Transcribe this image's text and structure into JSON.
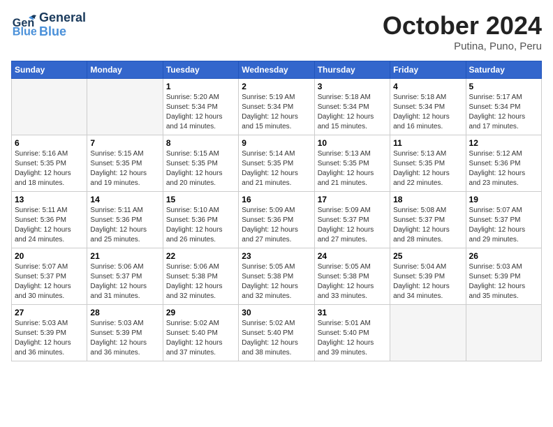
{
  "header": {
    "logo_general": "General",
    "logo_blue": "Blue",
    "month": "October 2024",
    "location": "Putina, Puno, Peru"
  },
  "weekdays": [
    "Sunday",
    "Monday",
    "Tuesday",
    "Wednesday",
    "Thursday",
    "Friday",
    "Saturday"
  ],
  "weeks": [
    [
      {
        "day": "",
        "sunrise": "",
        "sunset": "",
        "daylight": ""
      },
      {
        "day": "",
        "sunrise": "",
        "sunset": "",
        "daylight": ""
      },
      {
        "day": "1",
        "sunrise": "Sunrise: 5:20 AM",
        "sunset": "Sunset: 5:34 PM",
        "daylight": "Daylight: 12 hours and 14 minutes."
      },
      {
        "day": "2",
        "sunrise": "Sunrise: 5:19 AM",
        "sunset": "Sunset: 5:34 PM",
        "daylight": "Daylight: 12 hours and 15 minutes."
      },
      {
        "day": "3",
        "sunrise": "Sunrise: 5:18 AM",
        "sunset": "Sunset: 5:34 PM",
        "daylight": "Daylight: 12 hours and 15 minutes."
      },
      {
        "day": "4",
        "sunrise": "Sunrise: 5:18 AM",
        "sunset": "Sunset: 5:34 PM",
        "daylight": "Daylight: 12 hours and 16 minutes."
      },
      {
        "day": "5",
        "sunrise": "Sunrise: 5:17 AM",
        "sunset": "Sunset: 5:34 PM",
        "daylight": "Daylight: 12 hours and 17 minutes."
      }
    ],
    [
      {
        "day": "6",
        "sunrise": "Sunrise: 5:16 AM",
        "sunset": "Sunset: 5:35 PM",
        "daylight": "Daylight: 12 hours and 18 minutes."
      },
      {
        "day": "7",
        "sunrise": "Sunrise: 5:15 AM",
        "sunset": "Sunset: 5:35 PM",
        "daylight": "Daylight: 12 hours and 19 minutes."
      },
      {
        "day": "8",
        "sunrise": "Sunrise: 5:15 AM",
        "sunset": "Sunset: 5:35 PM",
        "daylight": "Daylight: 12 hours and 20 minutes."
      },
      {
        "day": "9",
        "sunrise": "Sunrise: 5:14 AM",
        "sunset": "Sunset: 5:35 PM",
        "daylight": "Daylight: 12 hours and 21 minutes."
      },
      {
        "day": "10",
        "sunrise": "Sunrise: 5:13 AM",
        "sunset": "Sunset: 5:35 PM",
        "daylight": "Daylight: 12 hours and 21 minutes."
      },
      {
        "day": "11",
        "sunrise": "Sunrise: 5:13 AM",
        "sunset": "Sunset: 5:35 PM",
        "daylight": "Daylight: 12 hours and 22 minutes."
      },
      {
        "day": "12",
        "sunrise": "Sunrise: 5:12 AM",
        "sunset": "Sunset: 5:36 PM",
        "daylight": "Daylight: 12 hours and 23 minutes."
      }
    ],
    [
      {
        "day": "13",
        "sunrise": "Sunrise: 5:11 AM",
        "sunset": "Sunset: 5:36 PM",
        "daylight": "Daylight: 12 hours and 24 minutes."
      },
      {
        "day": "14",
        "sunrise": "Sunrise: 5:11 AM",
        "sunset": "Sunset: 5:36 PM",
        "daylight": "Daylight: 12 hours and 25 minutes."
      },
      {
        "day": "15",
        "sunrise": "Sunrise: 5:10 AM",
        "sunset": "Sunset: 5:36 PM",
        "daylight": "Daylight: 12 hours and 26 minutes."
      },
      {
        "day": "16",
        "sunrise": "Sunrise: 5:09 AM",
        "sunset": "Sunset: 5:36 PM",
        "daylight": "Daylight: 12 hours and 27 minutes."
      },
      {
        "day": "17",
        "sunrise": "Sunrise: 5:09 AM",
        "sunset": "Sunset: 5:37 PM",
        "daylight": "Daylight: 12 hours and 27 minutes."
      },
      {
        "day": "18",
        "sunrise": "Sunrise: 5:08 AM",
        "sunset": "Sunset: 5:37 PM",
        "daylight": "Daylight: 12 hours and 28 minutes."
      },
      {
        "day": "19",
        "sunrise": "Sunrise: 5:07 AM",
        "sunset": "Sunset: 5:37 PM",
        "daylight": "Daylight: 12 hours and 29 minutes."
      }
    ],
    [
      {
        "day": "20",
        "sunrise": "Sunrise: 5:07 AM",
        "sunset": "Sunset: 5:37 PM",
        "daylight": "Daylight: 12 hours and 30 minutes."
      },
      {
        "day": "21",
        "sunrise": "Sunrise: 5:06 AM",
        "sunset": "Sunset: 5:37 PM",
        "daylight": "Daylight: 12 hours and 31 minutes."
      },
      {
        "day": "22",
        "sunrise": "Sunrise: 5:06 AM",
        "sunset": "Sunset: 5:38 PM",
        "daylight": "Daylight: 12 hours and 32 minutes."
      },
      {
        "day": "23",
        "sunrise": "Sunrise: 5:05 AM",
        "sunset": "Sunset: 5:38 PM",
        "daylight": "Daylight: 12 hours and 32 minutes."
      },
      {
        "day": "24",
        "sunrise": "Sunrise: 5:05 AM",
        "sunset": "Sunset: 5:38 PM",
        "daylight": "Daylight: 12 hours and 33 minutes."
      },
      {
        "day": "25",
        "sunrise": "Sunrise: 5:04 AM",
        "sunset": "Sunset: 5:39 PM",
        "daylight": "Daylight: 12 hours and 34 minutes."
      },
      {
        "day": "26",
        "sunrise": "Sunrise: 5:03 AM",
        "sunset": "Sunset: 5:39 PM",
        "daylight": "Daylight: 12 hours and 35 minutes."
      }
    ],
    [
      {
        "day": "27",
        "sunrise": "Sunrise: 5:03 AM",
        "sunset": "Sunset: 5:39 PM",
        "daylight": "Daylight: 12 hours and 36 minutes."
      },
      {
        "day": "28",
        "sunrise": "Sunrise: 5:03 AM",
        "sunset": "Sunset: 5:39 PM",
        "daylight": "Daylight: 12 hours and 36 minutes."
      },
      {
        "day": "29",
        "sunrise": "Sunrise: 5:02 AM",
        "sunset": "Sunset: 5:40 PM",
        "daylight": "Daylight: 12 hours and 37 minutes."
      },
      {
        "day": "30",
        "sunrise": "Sunrise: 5:02 AM",
        "sunset": "Sunset: 5:40 PM",
        "daylight": "Daylight: 12 hours and 38 minutes."
      },
      {
        "day": "31",
        "sunrise": "Sunrise: 5:01 AM",
        "sunset": "Sunset: 5:40 PM",
        "daylight": "Daylight: 12 hours and 39 minutes."
      },
      {
        "day": "",
        "sunrise": "",
        "sunset": "",
        "daylight": ""
      },
      {
        "day": "",
        "sunrise": "",
        "sunset": "",
        "daylight": ""
      }
    ]
  ]
}
